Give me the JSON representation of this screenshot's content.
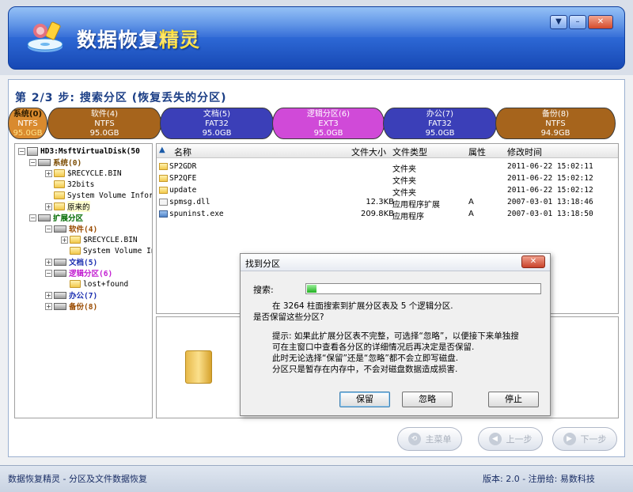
{
  "app": {
    "title_main": "数据恢复",
    "title_accent": "精灵"
  },
  "window_controls": {
    "menu": "▼",
    "minimize": "–",
    "close": "✕"
  },
  "step_title": "第 2/3 步: 搜索分区 (恢复丢失的分区)",
  "partitions": [
    {
      "name": "系统(0)",
      "fs": "NTFS",
      "size": "95.0GB",
      "color": "#d98a2e"
    },
    {
      "name": "软件(4)",
      "fs": "NTFS",
      "size": "95.0GB",
      "color": "#a6641c"
    },
    {
      "name": "文档(5)",
      "fs": "FAT32",
      "size": "95.0GB",
      "color": "#3b3fb8"
    },
    {
      "name": "逻辑分区(6)",
      "fs": "EXT3",
      "size": "95.0GB",
      "color": "#d04ad8"
    },
    {
      "name": "办公(7)",
      "fs": "FAT32",
      "size": "95.0GB",
      "color": "#3b3fb8"
    },
    {
      "name": "备份(8)",
      "fs": "NTFS",
      "size": "94.9GB",
      "color": "#a6641c"
    }
  ],
  "tree": {
    "disk": "HD3:MsftVirtualDisk(50",
    "items": [
      {
        "label": "系统(0)",
        "cls": "t-sys"
      },
      {
        "label": "$RECYCLE.BIN"
      },
      {
        "label": "32bits"
      },
      {
        "label": "System Volume Infor"
      },
      {
        "label": "原来的"
      },
      {
        "label": "扩展分区",
        "cls": "t-ext"
      },
      {
        "label": "软件(4)",
        "cls": "t-brown"
      },
      {
        "label": "$RECYCLE.BIN"
      },
      {
        "label": "System Volume In"
      },
      {
        "label": "文档(5)",
        "cls": "t-blue"
      },
      {
        "label": "逻辑分区(6)",
        "cls": "t-pink"
      },
      {
        "label": "lost+found"
      },
      {
        "label": "办公(7)",
        "cls": "t-blue"
      },
      {
        "label": "备份(8)",
        "cls": "t-brown"
      }
    ]
  },
  "filelist": {
    "columns": {
      "name": "名称",
      "size": "文件大小",
      "type": "文件类型",
      "attr": "属性",
      "time": "修改时间"
    },
    "rows": [
      {
        "name": "SP2GDR",
        "size": "",
        "type": "文件夹",
        "attr": "",
        "time": "2011-06-22 15:02:11",
        "icon": "folder"
      },
      {
        "name": "SP2QFE",
        "size": "",
        "type": "文件夹",
        "attr": "",
        "time": "2011-06-22 15:02:12",
        "icon": "folder"
      },
      {
        "name": "update",
        "size": "",
        "type": "文件夹",
        "attr": "",
        "time": "2011-06-22 15:02:12",
        "icon": "folder"
      },
      {
        "name": "spmsg.dll",
        "size": "12.3KB",
        "type": "应用程序扩展",
        "attr": "A",
        "time": "2007-03-01 13:18:46",
        "icon": "dll"
      },
      {
        "name": "spuninst.exe",
        "size": "209.8KB",
        "type": "应用程序",
        "attr": "A",
        "time": "2007-03-01 13:18:50",
        "icon": "exe"
      }
    ]
  },
  "nav": {
    "main_menu": "主菜单",
    "prev": "上一步",
    "next": "下一步"
  },
  "status": {
    "left": "数据恢复精灵 - 分区及文件数据恢复",
    "right": "版本: 2.0 - 注册给: 易数科技"
  },
  "dialog": {
    "title": "找到分区",
    "close": "✕",
    "search_label": "搜索:",
    "progress": 0.04,
    "line1": "在 3264 柱面搜索到扩展分区表及 5 个逻辑分区.",
    "line2": "是否保留这些分区?",
    "hint1": "提示: 如果此扩展分区表不完整，可选择“忽略”，以便接下来单独搜",
    "hint2": "可在主窗口中查看各分区的详细情况后再决定是否保留.",
    "hint3": "此时无论选择“保留”还是“忽略”都不会立即写磁盘.",
    "hint4": "分区只是暂存在内存中，不会对磁盘数据造成损害.",
    "btn_keep": "保留",
    "btn_ignore": "忽略",
    "btn_stop": "停止"
  }
}
